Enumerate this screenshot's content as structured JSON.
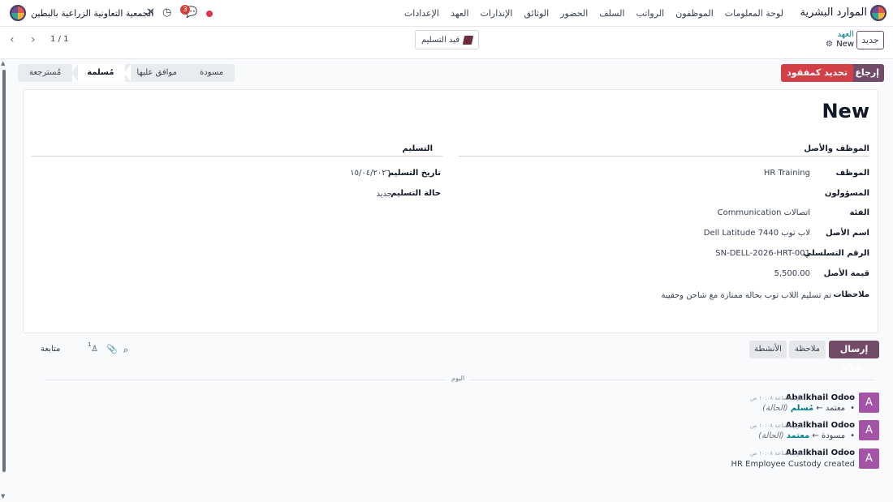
{
  "navbar": {
    "app_name": "الموارد البشرية",
    "menu": [
      "لوحة المعلومات",
      "الموظفون",
      "الرواتب",
      "السلف",
      "الحضور",
      "الوثائق",
      "الإنذارات",
      "العهد",
      "الإعدادات"
    ],
    "company_name": "الجمعية التعاونية الزراعية بالبطين",
    "chat_badge": "3"
  },
  "control": {
    "new_button": "جديد",
    "breadcrumb_parent": "العهد",
    "breadcrumb_current": "New",
    "receipt_button": "قيد التسليم",
    "pager_value": "1 / 1"
  },
  "actions": {
    "return_button": "إرجاع",
    "lost_button": "تحديد كمفقود"
  },
  "statusbar": {
    "stages": [
      "مسودة",
      "موافق عليها",
      "مُسلمة",
      "مُسترجعة"
    ],
    "active_index": 2
  },
  "form": {
    "title": "New",
    "group_employee_title": "الموظف والأصل",
    "group_delivery_title": "التسليم",
    "employee_fields": [
      {
        "label": "الموظف",
        "value": "HR Training"
      },
      {
        "label": "المسؤولون",
        "value": ""
      },
      {
        "label": "الفئة",
        "value": "Communication اتصالات"
      },
      {
        "label": "اسم الأصل",
        "value": "Dell Latitude 7440 لاب توب"
      },
      {
        "label": "الرقم التسلسلي",
        "value": "SN-DELL-2026-HRT-001"
      },
      {
        "label": "قيمة الأصل",
        "value": "5,500.00"
      },
      {
        "label": "ملاحظات",
        "value": "تم تسليم اللاب توب بحالة ممتازة مع شاحن وحقيبة"
      }
    ],
    "delivery_fields": [
      {
        "label": "تاريخ التسليم",
        "value": "١٥/٠٤/٢٠٢٦"
      },
      {
        "label": "حالة التسليم",
        "value": "جديد"
      }
    ]
  },
  "chatter": {
    "send_message": "إرسال رسالة",
    "log_note": "ملاحظة",
    "activities": "الأنشطة",
    "followers_count": "1",
    "follow": "متابعة",
    "date_label": "اليوم",
    "messages": [
      {
        "avatar": "A",
        "author": "Abalkhail Odoo",
        "time": "اليوم الساعة ١٠:٠٨ ص",
        "old": "معتمد",
        "new": "مُسلم",
        "field": "(الحالة)"
      },
      {
        "avatar": "A",
        "author": "Abalkhail Odoo",
        "time": "اليوم الساعة ١٠:٠٨ ص",
        "old": "مسودة",
        "new": "معتمد",
        "field": "(الحالة)"
      },
      {
        "avatar": "A",
        "author": "Abalkhail Odoo",
        "time": "اليوم الساعة ١٠:٠٨ ص",
        "body": "HR Employee Custody created"
      }
    ]
  }
}
